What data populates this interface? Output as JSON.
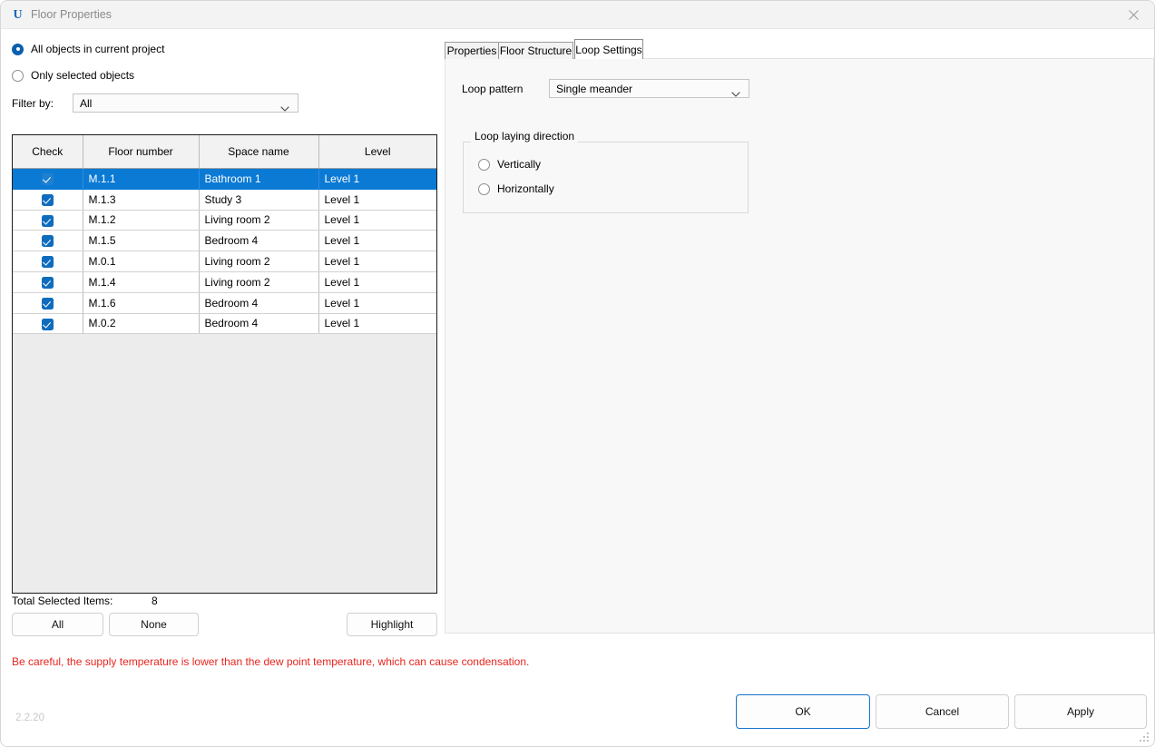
{
  "window": {
    "title": "Floor Properties",
    "app_icon": "U",
    "close_icon": "close-icon",
    "version": "2.2.20",
    "accent_color": "#0b7ad4",
    "warning_color": "#e8251f"
  },
  "scope": {
    "options": [
      {
        "label": "All objects in current project",
        "selected": true
      },
      {
        "label": "Only selected objects",
        "selected": false
      }
    ]
  },
  "filter": {
    "label": "Filter by:",
    "value": "All",
    "chevron_icon": "chevron-down-icon"
  },
  "table": {
    "columns": [
      "Check",
      "Floor number",
      "Space name",
      "Level"
    ],
    "rows": [
      {
        "check": true,
        "floor_number": "M.1.1",
        "space_name": "Bathroom 1",
        "level": "Level 1",
        "selected": true
      },
      {
        "check": true,
        "floor_number": "M.1.3",
        "space_name": "Study 3",
        "level": "Level 1",
        "selected": false
      },
      {
        "check": true,
        "floor_number": "M.1.2",
        "space_name": "Living room 2",
        "level": "Level 1",
        "selected": false
      },
      {
        "check": true,
        "floor_number": "M.1.5",
        "space_name": "Bedroom 4",
        "level": "Level 1",
        "selected": false
      },
      {
        "check": true,
        "floor_number": "M.0.1",
        "space_name": "Living room 2",
        "level": "Level 1",
        "selected": false
      },
      {
        "check": true,
        "floor_number": "M.1.4",
        "space_name": "Living room 2",
        "level": "Level 1",
        "selected": false
      },
      {
        "check": true,
        "floor_number": "M.1.6",
        "space_name": "Bedroom 4",
        "level": "Level 1",
        "selected": false
      },
      {
        "check": true,
        "floor_number": "M.0.2",
        "space_name": "Bedroom 4",
        "level": "Level 1",
        "selected": false
      }
    ]
  },
  "selection_summary": {
    "label": "Total Selected Items:",
    "value": "8"
  },
  "selection_buttons": {
    "all": "All",
    "none": "None",
    "highlight": "Highlight"
  },
  "tabs": [
    {
      "label": "Properties",
      "active": false
    },
    {
      "label": "Floor Structure",
      "active": false
    },
    {
      "label": "Loop Settings",
      "active": true
    }
  ],
  "loop_settings": {
    "pattern_label": "Loop pattern",
    "pattern_value": "Single meander",
    "pattern_chevron_icon": "chevron-down-icon",
    "direction_group_title": "Loop laying direction",
    "direction_options": [
      {
        "label": "Vertically",
        "selected": false
      },
      {
        "label": "Horizontally",
        "selected": false
      }
    ]
  },
  "warning": {
    "text": "Be careful, the supply temperature is lower than the dew point temperature, which can cause condensation."
  },
  "footer": {
    "ok": "OK",
    "cancel": "Cancel",
    "apply": "Apply"
  }
}
